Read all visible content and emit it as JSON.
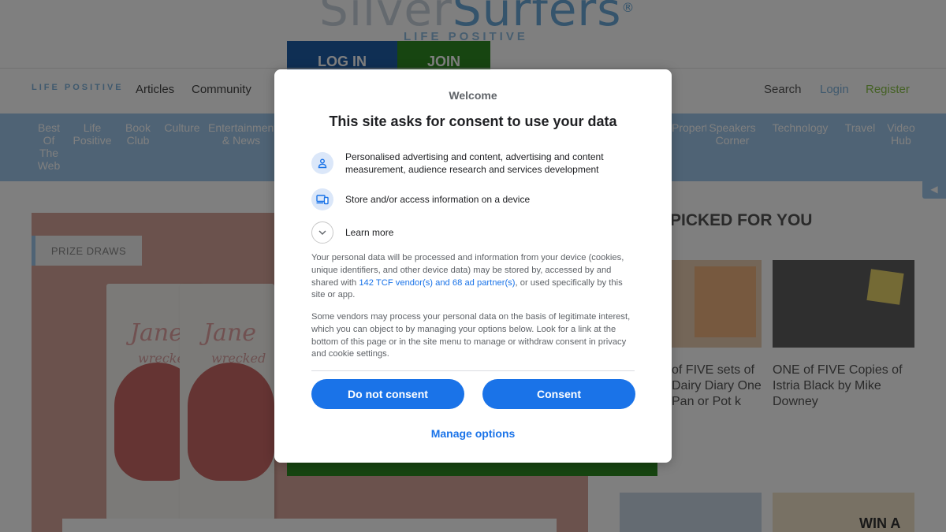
{
  "site": {
    "logo_part1": "Silver",
    "logo_part2": "Surfers",
    "logo_mark": "®",
    "tagline": "LIFE POSITIVE",
    "login_label": "LOG IN",
    "join_label": "JOIN",
    "nav_logo": "LIFE POSITIVE",
    "nav": [
      "Articles",
      "Community"
    ],
    "nav_right": {
      "search": "Search",
      "login": "Login",
      "register": "Register"
    },
    "categories_left": [
      "Best Of The Web",
      "Life Positive",
      "Book Club",
      "Culture",
      "Entertainment & News"
    ],
    "categories_right": [
      "Property",
      "Speakers Corner",
      "Technology",
      "Travel",
      "Video Hub"
    ],
    "side_tab_icon": "◀",
    "feature_label": "PRIZE DRAWS",
    "dvd_title": "Jane",
    "dvd_subtitle": "wrecked",
    "picked_title": "PICKED FOR YOU",
    "card1_text": "of FIVE sets of Dairy Diary One Pan or Pot k",
    "card2_text": "ONE of FIVE Copies of Istria Black by Mike Downey",
    "bottom_card_text": "WIN A"
  },
  "dialog": {
    "site_name": "Welcome",
    "title": "This site asks for consent to use your data",
    "purposes": [
      {
        "icon": "person-icon",
        "text": "Personalised advertising and content, advertising and content measurement, audience research and services development"
      },
      {
        "icon": "devices-icon",
        "text": "Store and/or access information on a device"
      },
      {
        "icon": "chevron-down-icon",
        "text": "Learn more"
      }
    ],
    "para1_before": "Your personal data will be processed and information from your device (cookies, unique identifiers, and other device data) may be stored by, accessed by and shared with ",
    "para1_link": "142 TCF vendor(s) and 68 ad partner(s)",
    "para1_after": ", or used specifically by this site or app.",
    "para2": "Some vendors may process your personal data on the basis of legitimate interest, which you can object to by managing your options below. Look for a link at the bottom of this page or in the site menu to manage or withdraw consent in privacy and cookie settings.",
    "do_not_consent_label": "Do not consent",
    "consent_label": "Consent",
    "manage_options_label": "Manage options"
  },
  "colors": {
    "accent": "#1a73e8",
    "overlay": "rgba(0,0,0,0.5)",
    "site_blue": "#9fc7ea",
    "join_green": "#2e8a22",
    "login_blue": "#1f5ea8"
  }
}
